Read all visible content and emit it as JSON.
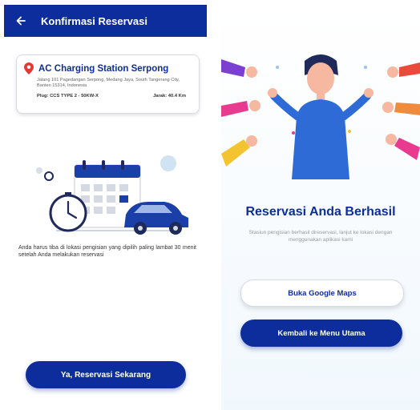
{
  "left_screen": {
    "app_bar": {
      "title": "Konfirmasi Reservasi",
      "back_icon": "arrow-left-icon"
    },
    "station_card": {
      "name": "AC Charging Station Serpong",
      "address": "Jalang 101 Pagedangan Serpong, Medang Jaya, South Tangerang City, Banten 15314, Indonesia",
      "plug": "Plug: CCS TYPE 2 - 50KW-X",
      "distance": "Jarak: 40.4 Km"
    },
    "notice": "Anda harus tiba di lokasi pengisian yang dipilih paling lambat 30 menit setelah Anda melakukan reservasi",
    "reserve_button": "Ya, Reservasi Sekarang"
  },
  "right_screen": {
    "title": "Reservasi Anda Berhasil",
    "description": "Stasiun pengisian berhasil direservasi, lanjut ke lokasi dengan menggunakan aplikasi kami",
    "maps_button": "Buka Google Maps",
    "menu_button": "Kembali ke Menu Utama"
  },
  "colors": {
    "primary": "#0d2d9c",
    "card_border": "#d9dce3",
    "pin": "#e53935",
    "muted_text": "#999999"
  }
}
